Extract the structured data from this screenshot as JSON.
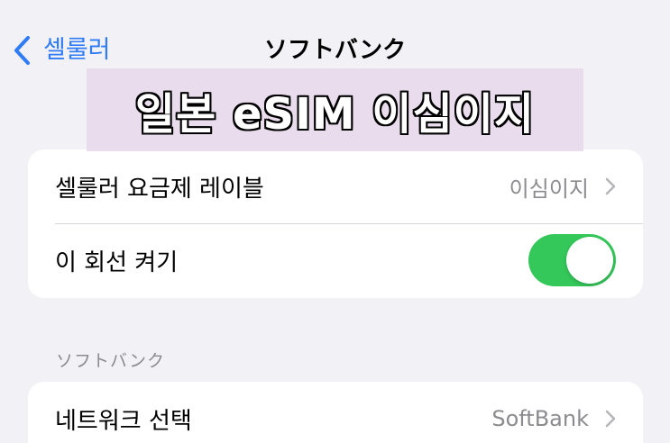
{
  "nav": {
    "back_label": "셀룰러",
    "title": "ソフトバンク"
  },
  "banner": {
    "text": "일본 eSIM 이심이지"
  },
  "plan_group": {
    "label_row": {
      "label": "셀룰러 요금제 레이블",
      "value": "이심이지"
    },
    "toggle_row": {
      "label": "이 회선 켜기",
      "toggle_on": true
    }
  },
  "carrier_section": {
    "header": "ソフトバンク",
    "network_row": {
      "label": "네트워크 선택",
      "value": "SoftBank"
    }
  },
  "colors": {
    "accent": "#2f7cf6",
    "toggle_on": "#34c759",
    "background": "#f1f1f6"
  }
}
